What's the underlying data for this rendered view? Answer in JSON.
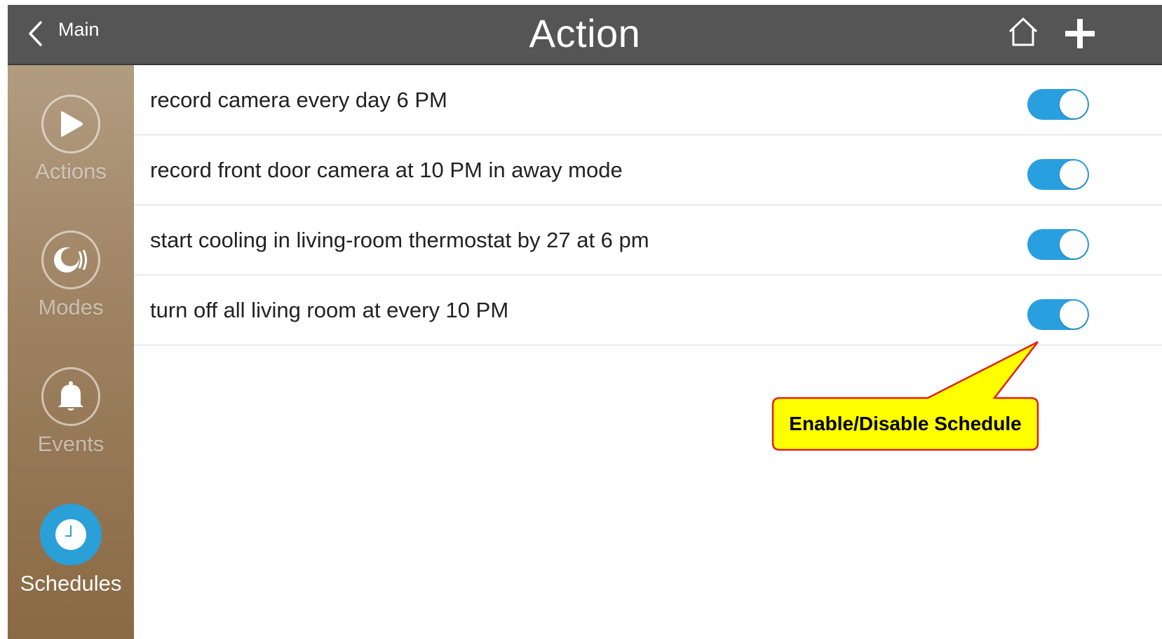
{
  "header": {
    "back_label": "Main",
    "title": "Action"
  },
  "sidebar": {
    "items": [
      {
        "label": "Actions",
        "icon": "play-icon",
        "active": false
      },
      {
        "label": "Modes",
        "icon": "modes-icon",
        "active": false
      },
      {
        "label": "Events",
        "icon": "bell-icon",
        "active": false
      },
      {
        "label": "Schedules",
        "icon": "clock-icon",
        "active": true
      }
    ]
  },
  "schedules": [
    {
      "text": "record camera every day 6 PM",
      "enabled": true
    },
    {
      "text": "record front door camera at 10 PM in away mode",
      "enabled": true
    },
    {
      "text": "start cooling in living-room thermostat by 27 at 6 pm",
      "enabled": true
    },
    {
      "text": "turn off all living room at every 10 PM",
      "enabled": true
    }
  ],
  "annotation": {
    "text": "Enable/Disable Schedule"
  },
  "colors": {
    "header_bg": "#555555",
    "accent": "#2a9fe0",
    "callout_fill": "#ffff00",
    "callout_border": "#e02020"
  }
}
